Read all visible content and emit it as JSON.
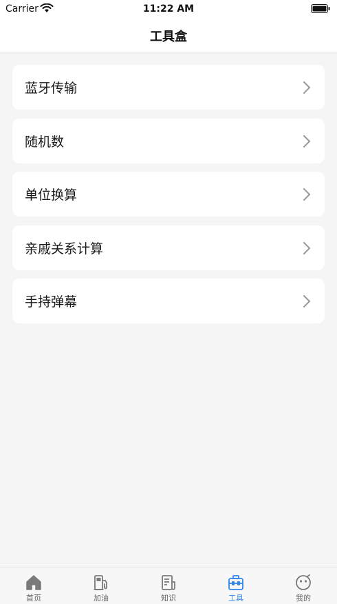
{
  "status": {
    "carrier": "Carrier",
    "time": "11:22 AM"
  },
  "nav": {
    "title": "工具盒"
  },
  "tools": [
    {
      "label": "蓝牙传输"
    },
    {
      "label": "随机数"
    },
    {
      "label": "单位换算"
    },
    {
      "label": "亲戚关系计算"
    },
    {
      "label": "手持弹幕"
    }
  ],
  "tabs": [
    {
      "label": "首页",
      "icon": "home-icon"
    },
    {
      "label": "加油",
      "icon": "fuel-pump-icon"
    },
    {
      "label": "知识",
      "icon": "document-icon"
    },
    {
      "label": "工具",
      "icon": "toolbox-icon",
      "active": true
    },
    {
      "label": "我的",
      "icon": "smiley-icon"
    }
  ],
  "colors": {
    "accent": "#2f86e8",
    "inactive": "#666666",
    "background": "#f5f5f5"
  }
}
